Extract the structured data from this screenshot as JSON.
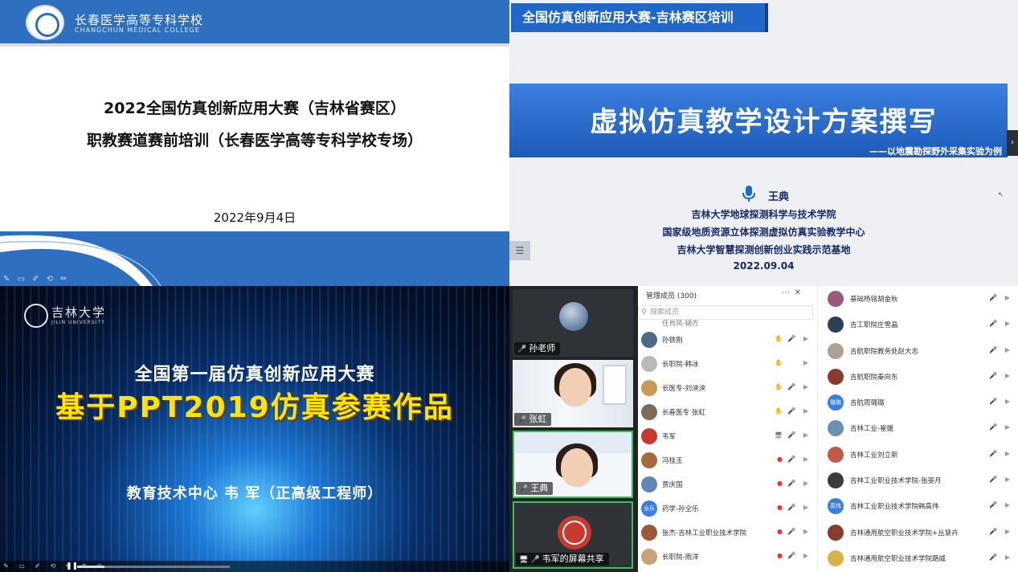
{
  "top_left_slide": {
    "college_name_cn": "长春医学高等专科学校",
    "college_name_en": "CHANGCHUN MEDICAL COLLEGE",
    "title_line1": "2022全国仿真创新应用大赛（吉林省赛区）",
    "title_line2": "职教赛道赛前培训（长春医学高等专科学校专场）",
    "date": "2022年9月4日",
    "accent_color": "#2e6fc0"
  },
  "top_right_slide": {
    "badge": "全国仿真创新应用大赛-吉林赛区培训",
    "main_title": "虚拟仿真教学设计方案撰写",
    "subtitle": "——以地震勘探野外采集实验为例",
    "speaker": "王典",
    "affiliations": [
      "吉林大学地球探测科学与技术学院",
      "国家级地质资源立体探测虚拟仿真实验教学中心",
      "吉林大学智慧探测创新创业实践示范基地",
      "2022.09.04"
    ],
    "next_icon": "chevron-right-icon",
    "menu_icon": "list-icon",
    "accent_color": "#2167c9"
  },
  "bottom_left_slide": {
    "university_cn": "吉林大学",
    "university_en": "JILIN UNIVERSITY",
    "line1": "全国第一届仿真创新应用大赛",
    "line2": "基于PPT2019仿真参赛作品",
    "line3": "教育技术中心  韦  军（正高级工程师）",
    "highlight_color": "#ffe400",
    "playback_progress": 0.18
  },
  "video_tiles": [
    {
      "name": "孙老师",
      "state": "mic-muted"
    },
    {
      "name": "张虹",
      "state": "mic-muted"
    },
    {
      "name": "王典",
      "state": "speaking",
      "poster_caption": "吉林大学地球探测科学与技术学院"
    },
    {
      "name": "韦军的屏幕共享",
      "state": "sharing"
    }
  ],
  "member_panel": {
    "title": "管理成员 (300)",
    "more_icon": "more-icon",
    "close_icon": "close-icon",
    "search_placeholder": "搜索成员",
    "partial_row": "任肖凤-镜方",
    "members": [
      {
        "name": "孙铁刚",
        "status": "hand",
        "av": "#4a6b8a",
        "av_text": ""
      },
      {
        "name": "长职院-韩冰",
        "status": "hand-only",
        "av": "#b9b9b9",
        "av_text": ""
      },
      {
        "name": "长医专-刘泱泱",
        "status": "hand",
        "av": "#c79a55",
        "av_text": ""
      },
      {
        "name": "长春医专 张虹",
        "status": "hand",
        "av": "#7f6a5a",
        "av_text": ""
      },
      {
        "name": "韦军",
        "status": "share",
        "av": "#c83a2d",
        "av_text": ""
      },
      {
        "name": "冯桂玉",
        "status": "rec",
        "av": "#a66a3c",
        "av_text": ""
      },
      {
        "name": "贾庆国",
        "status": "rec",
        "av": "#5f86b5",
        "av_text": ""
      },
      {
        "name": "药学-孙全乐",
        "status": "rec",
        "av": "#3a7de0",
        "av_text": "全乐"
      },
      {
        "name": "张杰-吉林工业职业技术学院",
        "status": "rec",
        "av": "#9b5a3a",
        "av_text": ""
      },
      {
        "name": "长职院-雨洋",
        "status": "rec",
        "av": "#c9a27a",
        "av_text": ""
      }
    ]
  },
  "member_list_right": [
    {
      "name": "基础杨铭胡金秋",
      "av": "#9a5a7a",
      "av_text": ""
    },
    {
      "name": "吉工职院庄雪晶",
      "av": "#2f3f55",
      "av_text": ""
    },
    {
      "name": "吉航职院教务处赵大志",
      "av": "#b0a090",
      "av_text": ""
    },
    {
      "name": "吉航职院秦向东",
      "av": "#8a3b2f",
      "av_text": ""
    },
    {
      "name": "吉航周璐璐",
      "av": "#3a7de0",
      "av_text": "璐璐"
    },
    {
      "name": "吉林工业-崔媛",
      "av": "#6a8fb0",
      "av_text": ""
    },
    {
      "name": "吉林工业刘立新",
      "av": "#c05a4a",
      "av_text": ""
    },
    {
      "name": "吉林工业职业技术学院-张斐月",
      "av": "#3b3b3b",
      "av_text": ""
    },
    {
      "name": "吉林工业职业技术学院韩高伟",
      "av": "#3a7de0",
      "av_text": "高伟"
    },
    {
      "name": "吉林通用航空职业技术学院+丛慧卉",
      "av": "#8a3b2f",
      "av_text": ""
    },
    {
      "name": "吉林通用航空职业技术学院路威",
      "av": "#d6b34a",
      "av_text": ""
    }
  ]
}
